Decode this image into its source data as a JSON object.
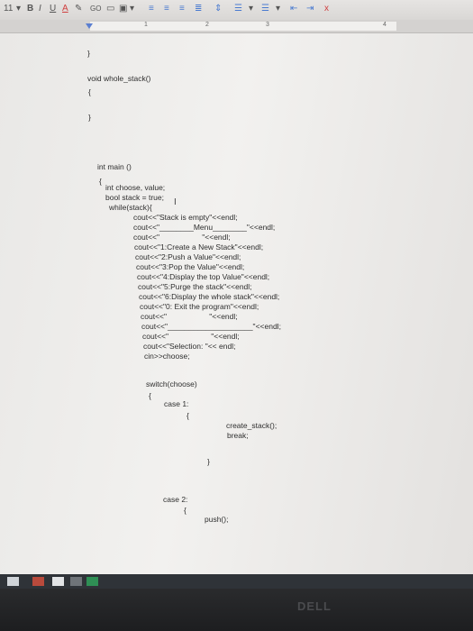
{
  "toolbar": {
    "font_size": "11",
    "bold": "B",
    "italic": "I",
    "underline": "U",
    "text_color": "A",
    "link": "GO",
    "clear_format": "x"
  },
  "ruler": {
    "marks": [
      "1",
      "2",
      "3",
      "4"
    ]
  },
  "document": {
    "lines": [
      "}",
      "void whole_stack()",
      "{",
      "}",
      "int main ()",
      "{",
      "int choose, value;",
      "bool stack = true;",
      "while(stack){",
      "cout<<\"Stack is empty\"<<endl;",
      "cout<<\"________Menu________\"<<endl;",
      "cout<<\"                    \"<<endl;",
      "cout<<\"1:Create a New Stack\"<<endl;",
      "cout<<\"2:Push a Value\"<<endl;",
      "cout<<\"3:Pop the Value\"<<endl;",
      "cout<<\"4:Display the top Value\"<<endl;",
      "cout<<\"5:Purge the stack\"<<endl;",
      "cout<<\"6:Display the whole stack\"<<endl;",
      "cout<<\"0: Exit the program\"<<endl;",
      "cout<<\"                    \"<<endl;",
      "cout<<\"____________________\"<<endl;",
      "cout<<\"                    \"<<endl;",
      "cout<<\"Selection: \"<< endl;",
      "cin>>choose;",
      "switch(choose)",
      "{",
      "case 1:",
      "{",
      "create_stack();",
      "break;",
      "}",
      "case 2:",
      "{",
      "push();"
    ]
  },
  "taskbar": {
    "icons": [
      "start-icon",
      "file-explorer-icon",
      "browser-icon",
      "app-icon",
      "app2-icon"
    ]
  },
  "bezel": {
    "brand": "DELL"
  },
  "colors": {
    "page": "#efeeec",
    "toolbar": "#dedcda",
    "taskbar": "#2f3338",
    "bezel": "#222325"
  }
}
